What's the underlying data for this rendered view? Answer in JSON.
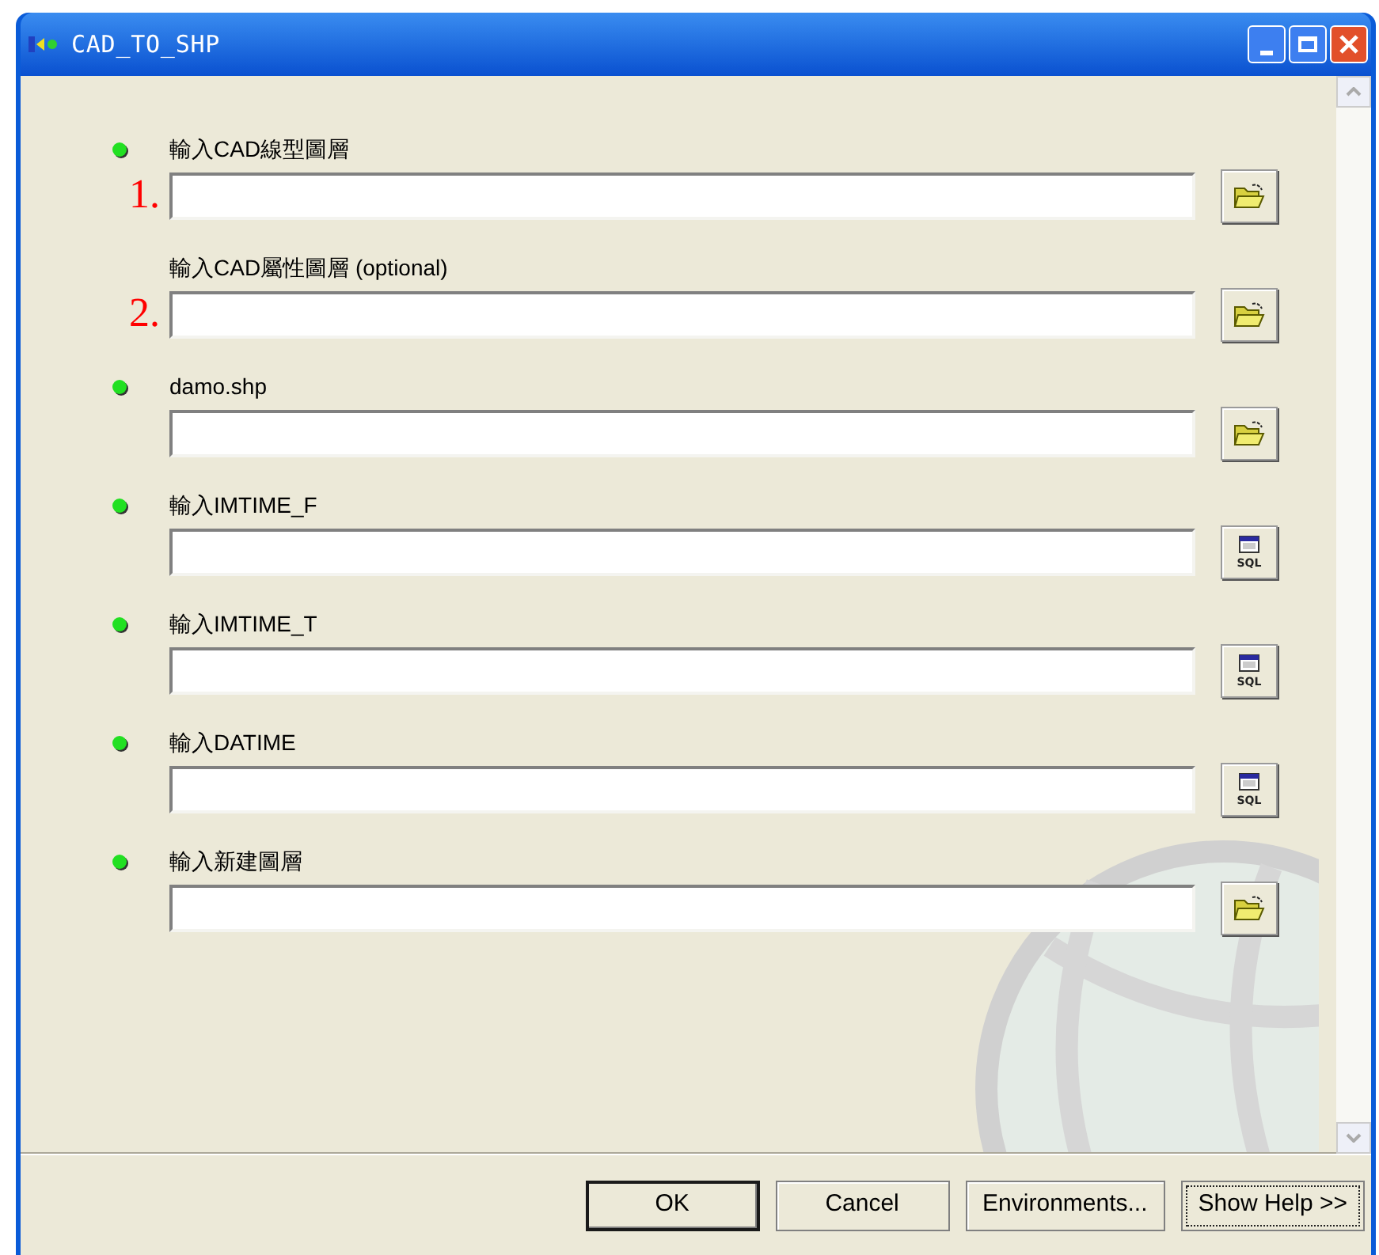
{
  "window": {
    "title": "CAD_TO_SHP"
  },
  "parameters": [
    {
      "label": "輸入CAD線型圖層",
      "required": true,
      "kind": "folder",
      "annotation": "1."
    },
    {
      "label": "輸入CAD屬性圖層 (optional)",
      "required": false,
      "kind": "folder",
      "annotation": "2."
    },
    {
      "label": "damo.shp",
      "required": true,
      "kind": "folder"
    },
    {
      "label": "輸入IMTIME_F",
      "required": true,
      "kind": "query",
      "icon_text": "SQL"
    },
    {
      "label": "輸入IMTIME_T",
      "required": true,
      "kind": "query",
      "icon_text": "SQL"
    },
    {
      "label": "輸入DATIME",
      "required": true,
      "kind": "query",
      "icon_text": "SQL"
    },
    {
      "label": "輸入新建圖層",
      "required": true,
      "kind": "folder"
    }
  ],
  "buttons": [
    {
      "label": "OK",
      "kind": "default"
    },
    {
      "label": "Cancel",
      "kind": "normal"
    },
    {
      "label": "Environments...",
      "kind": "normal"
    },
    {
      "label": "Show Help >>",
      "kind": "focused"
    }
  ]
}
